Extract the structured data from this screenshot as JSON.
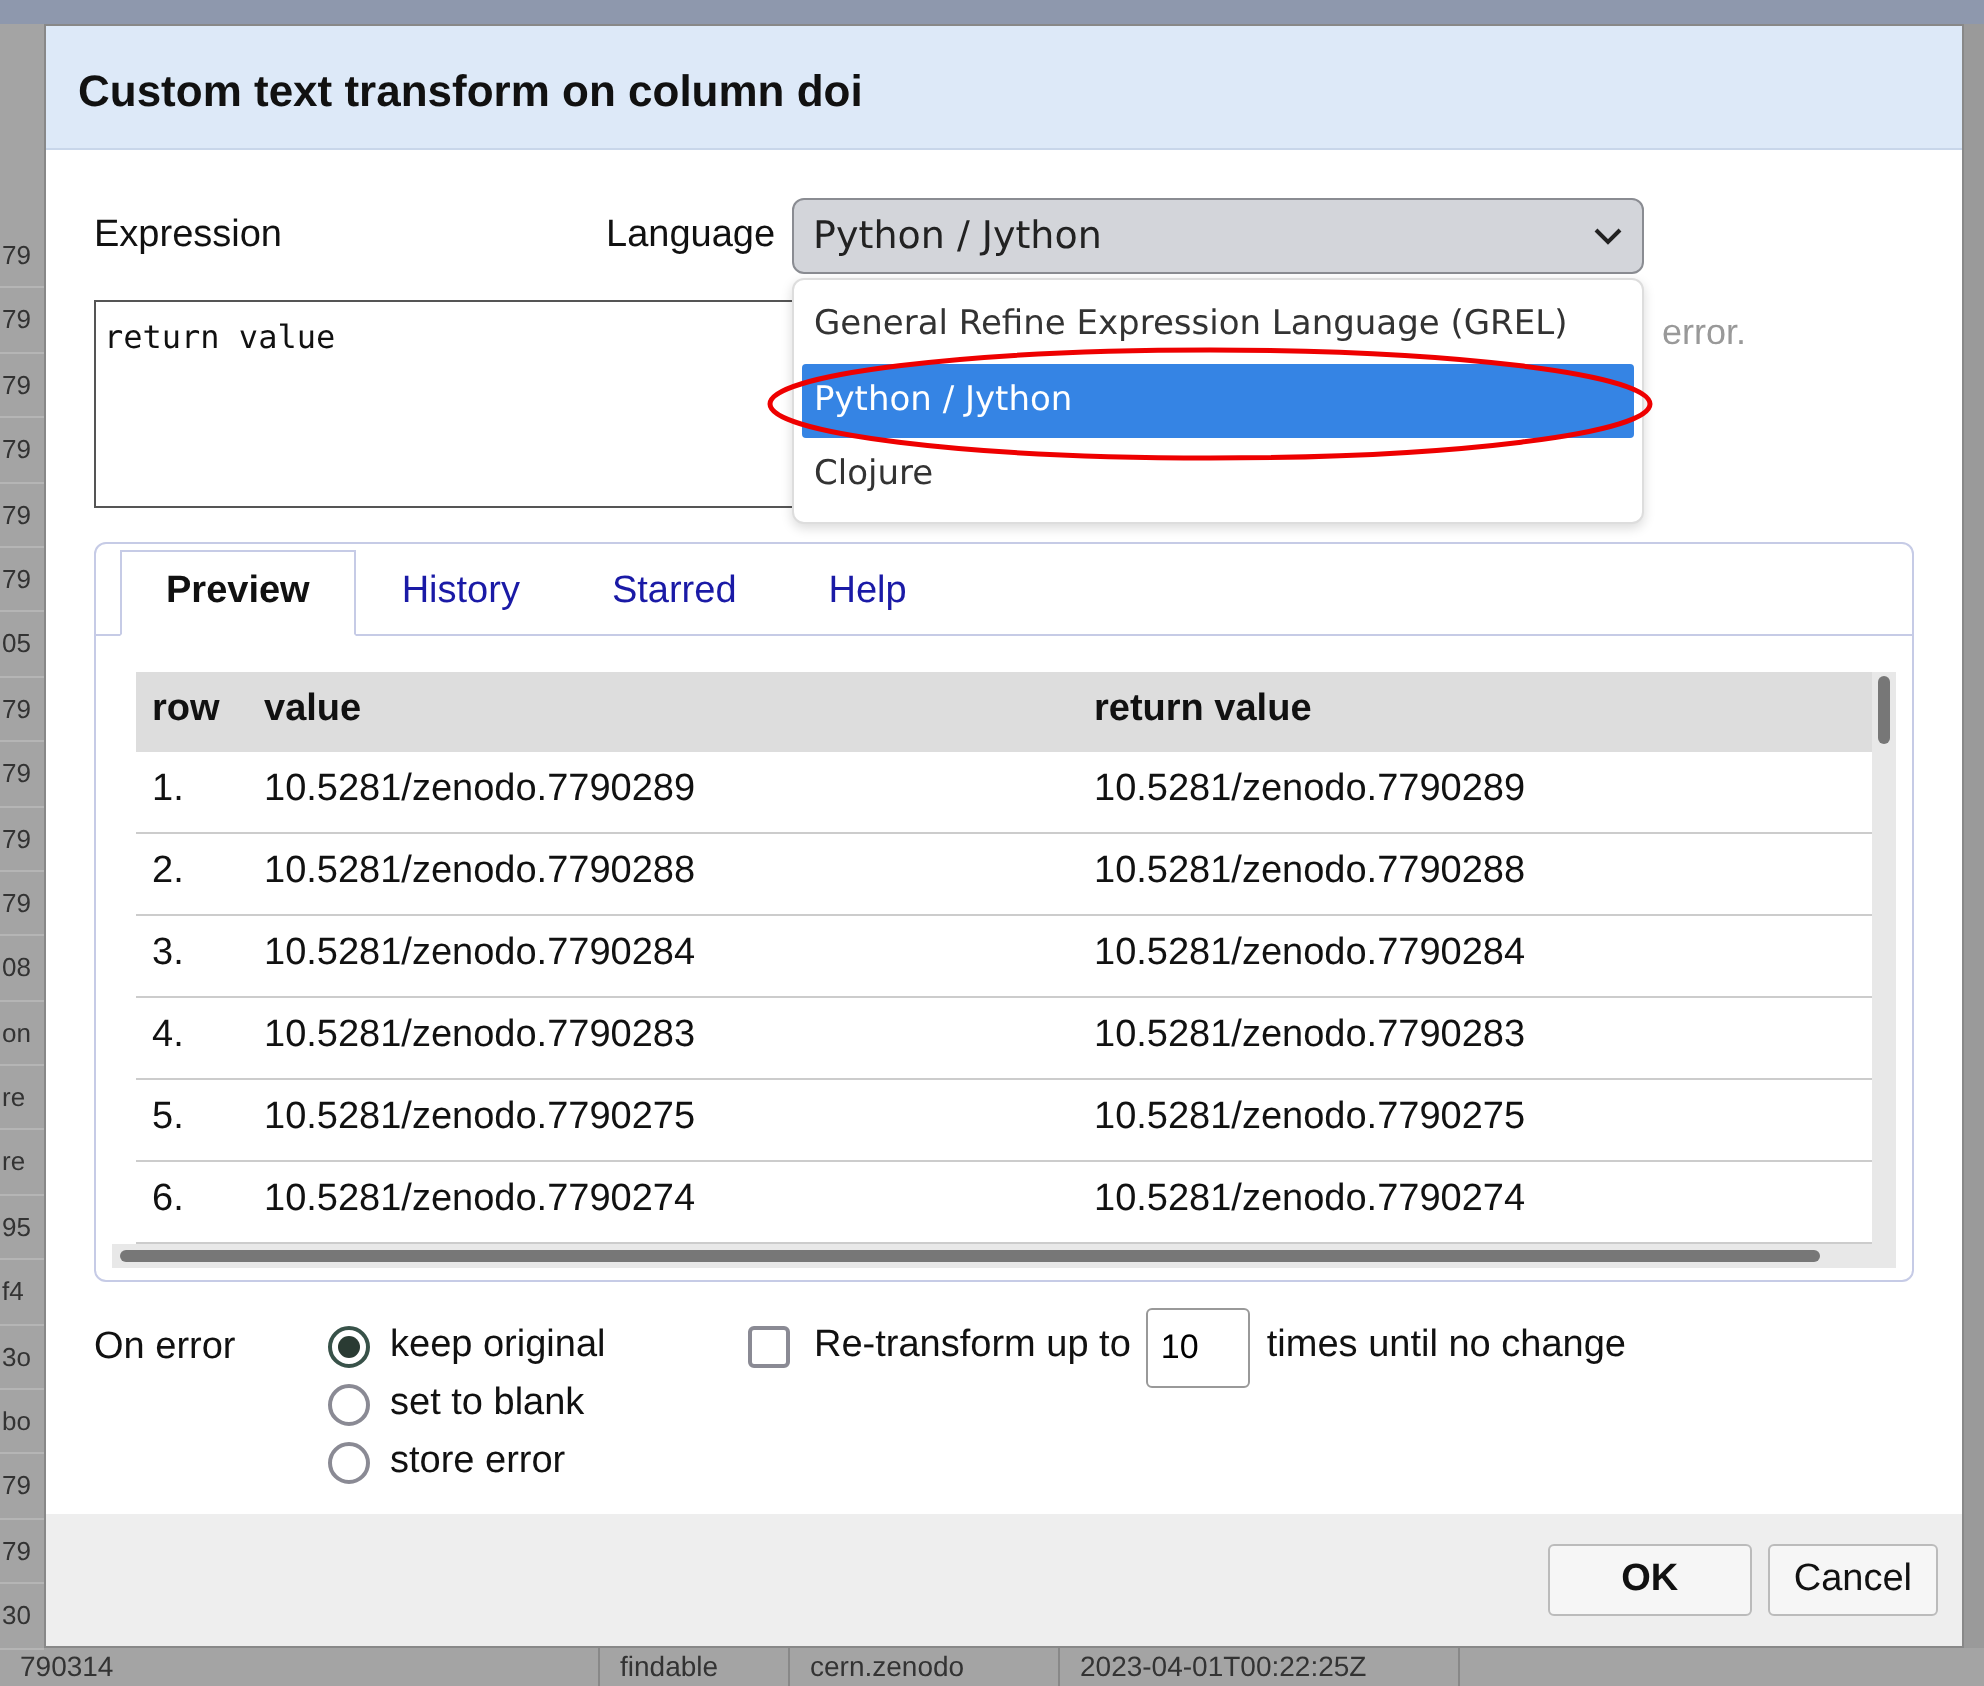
{
  "background": {
    "edge_cells": [
      "79",
      "79",
      "79",
      "79",
      "79",
      "79",
      "05",
      "79",
      "79",
      "79",
      "79",
      "08",
      "on",
      "re",
      "re",
      "95",
      "f4",
      "3o",
      "bo",
      "79",
      "79",
      "30"
    ],
    "bottom_row": [
      "790314",
      "findable",
      "cern.zenodo",
      "2023-04-01T00:22:25Z"
    ]
  },
  "dialog": {
    "title": "Custom text transform on column doi",
    "expression_label": "Expression",
    "language_label": "Language",
    "language_select": {
      "value": "Python / Jython",
      "expanded": true
    },
    "language_options": [
      {
        "label": "General Refine Expression Language (GREL)",
        "selected": false
      },
      {
        "label": "Python / Jython",
        "selected": true
      },
      {
        "label": "Clojure",
        "selected": false
      }
    ],
    "expression": "return value",
    "hint": "error.",
    "tabs": [
      {
        "label": "Preview",
        "selected": true
      },
      {
        "label": "History",
        "selected": false
      },
      {
        "label": "Starred",
        "selected": false
      },
      {
        "label": "Help",
        "selected": false
      }
    ],
    "preview": {
      "columns": [
        "row",
        "value",
        "return value"
      ],
      "rows": [
        [
          "1.",
          "10.5281/zenodo.7790289",
          "10.5281/zenodo.7790289"
        ],
        [
          "2.",
          "10.5281/zenodo.7790288",
          "10.5281/zenodo.7790288"
        ],
        [
          "3.",
          "10.5281/zenodo.7790284",
          "10.5281/zenodo.7790284"
        ],
        [
          "4.",
          "10.5281/zenodo.7790283",
          "10.5281/zenodo.7790283"
        ],
        [
          "5.",
          "10.5281/zenodo.7790275",
          "10.5281/zenodo.7790275"
        ],
        [
          "6.",
          "10.5281/zenodo.7790274",
          "10.5281/zenodo.7790274"
        ]
      ]
    },
    "on_error_label": "On error",
    "on_error_options": [
      {
        "label": "keep original",
        "selected": true
      },
      {
        "label": "set to blank",
        "selected": false
      },
      {
        "label": "store error",
        "selected": false
      }
    ],
    "retransform": {
      "checked": false,
      "label_before": "Re-transform up to",
      "value": "10",
      "label_after": "times until no change"
    },
    "buttons": [
      {
        "label": "OK",
        "kind": "primary"
      },
      {
        "label": "Cancel",
        "kind": "secondary"
      }
    ]
  }
}
